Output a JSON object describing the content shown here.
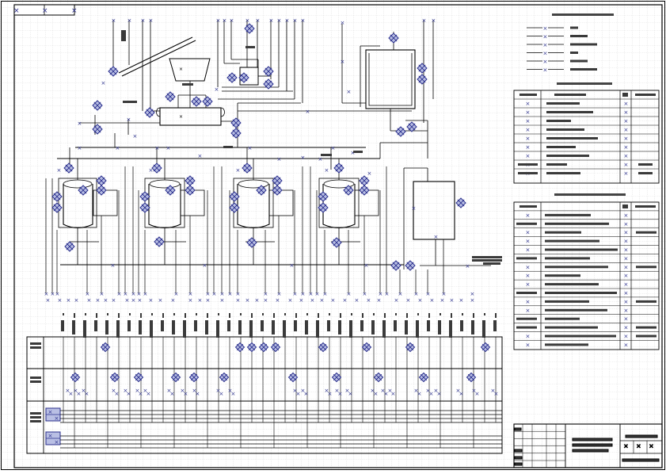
{
  "sheet": {
    "background": "#ffffff",
    "grid_color": "#c6c6c6",
    "line_color": "#000000",
    "symbol_color": "#2a2f8c",
    "symbol_fill": "#b9bfe4",
    "text_glyph": "▒"
  },
  "title_stamp": {
    "mark_glyph": "×"
  },
  "process": {
    "tanks": [
      {
        "id": "tank-1"
      },
      {
        "id": "tank-2"
      },
      {
        "id": "tank-3"
      },
      {
        "id": "tank-4"
      }
    ],
    "hopper": {
      "id": "hopper"
    },
    "mixer": {
      "id": "mixer"
    },
    "separator": {
      "id": "separator"
    },
    "receiver": {
      "id": "receiver"
    }
  },
  "legend_rows": 6,
  "table_1_rows": 10,
  "table_2_rows": 17,
  "panel": {
    "row_labels": 3,
    "instrument_count": 40
  }
}
